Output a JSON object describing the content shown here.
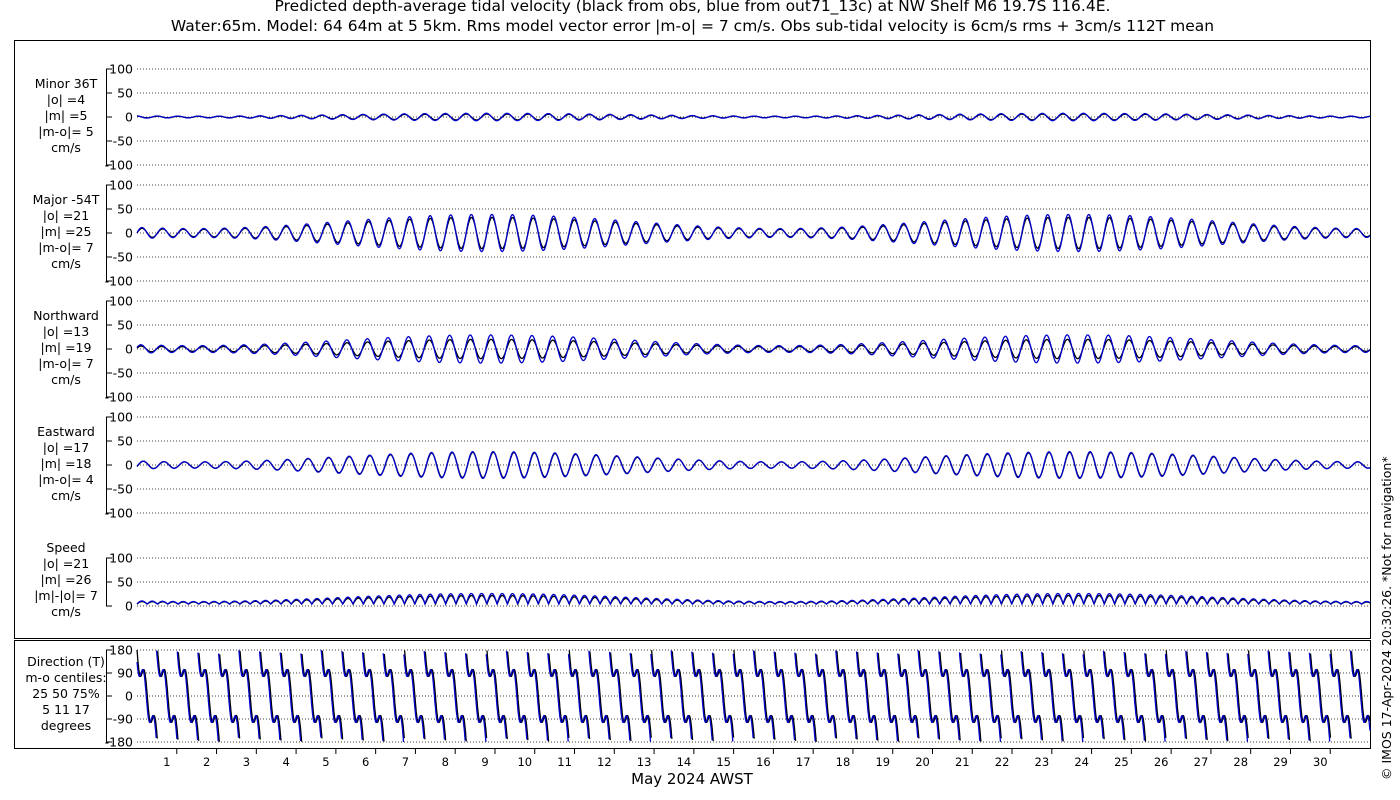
{
  "title_line1": "Predicted depth-average tidal velocity (black from obs, blue from out71_13c) at NW Shelf M6 19.7S 116.4E.",
  "title_line2": "Water:65m. Model: 64 64m at 5 5km. Rms model vector error |m-o| = 7 cm/s. Obs sub-tidal velocity is 6cm/s rms + 3cm/s 112T mean",
  "watermark": "© IMOS 17-Apr-2024 20:30:26. *Not for navigation*",
  "colors": {
    "obs": "#000000",
    "model": "#0000cc",
    "grid": "#000000"
  },
  "chart_data": {
    "type": "line",
    "xlabel": "May 2024 AWST",
    "x_range_days": [
      0,
      31
    ],
    "x_ticks": [
      "1",
      "2",
      "3",
      "4",
      "5",
      "6",
      "7",
      "8",
      "9",
      "10",
      "11",
      "12",
      "13",
      "14",
      "15",
      "16",
      "17",
      "18",
      "19",
      "20",
      "21",
      "22",
      "23",
      "24",
      "25",
      "26",
      "27",
      "28",
      "29",
      "30"
    ],
    "grid": true,
    "series_legend": {
      "obs": "black from obs",
      "model": "blue from out71_13c"
    },
    "panels": [
      {
        "id": "minor",
        "label_lines": [
          "Minor 36T",
          "|o| =4",
          "|m| =5",
          "|m-o|= 5",
          "cm/s"
        ],
        "ylim": [
          -100,
          100
        ],
        "yticks": [
          "100",
          "50",
          "0",
          "-50",
          "-100"
        ],
        "tick_values": [
          100,
          50,
          0,
          -50,
          -100
        ],
        "kind": "component",
        "amp_obs": 4,
        "amp_model": 5,
        "phase_shift": 1.6,
        "phase_lag": 0.1
      },
      {
        "id": "major",
        "label_lines": [
          "Major -54T",
          "|o| =21",
          "|m| =25",
          "|m-o|= 7",
          "cm/s"
        ],
        "ylim": [
          -100,
          100
        ],
        "yticks": [
          "100",
          "50",
          "0",
          "-50",
          "-100"
        ],
        "tick_values": [
          100,
          50,
          0,
          -50,
          -100
        ],
        "kind": "component",
        "amp_obs": 21,
        "amp_model": 25,
        "phase_shift": 0,
        "phase_lag": 0.05
      },
      {
        "id": "north",
        "label_lines": [
          "Northward",
          "|o| =13",
          "|m| =19",
          "|m-o|= 7",
          "cm/s"
        ],
        "ylim": [
          -100,
          100
        ],
        "yticks": [
          "100",
          "50",
          "0",
          "-50",
          "-100"
        ],
        "tick_values": [
          100,
          50,
          0,
          -50,
          -100
        ],
        "kind": "component",
        "amp_obs": 13,
        "amp_model": 19,
        "phase_shift": 0.3,
        "phase_lag": 0.08
      },
      {
        "id": "east",
        "label_lines": [
          "Eastward",
          "|o| =17",
          "|m| =18",
          "|m-o|= 4",
          "cm/s"
        ],
        "ylim": [
          -100,
          100
        ],
        "yticks": [
          "100",
          "50",
          "0",
          "-50",
          "-100"
        ],
        "tick_values": [
          100,
          50,
          0,
          -50,
          -100
        ],
        "kind": "component",
        "amp_obs": 17,
        "amp_model": 18,
        "phase_shift": -0.4,
        "phase_lag": 0.06
      },
      {
        "id": "speed",
        "label_lines": [
          "Speed",
          "|o| =21",
          "|m| =26",
          "|m|-|o|= 7",
          "cm/s"
        ],
        "ylim": [
          0,
          100
        ],
        "yticks": [
          "100",
          "50",
          "0"
        ],
        "tick_values": [
          100,
          50,
          0
        ],
        "kind": "speed",
        "amp_obs": 21,
        "amp_model": 26,
        "phase_shift": 0,
        "phase_lag": 0.05
      },
      {
        "id": "direction",
        "label_lines": [
          "Direction (T)",
          "m-o centiles:",
          "25  50  75%",
          "5  11  17",
          "degrees"
        ],
        "ylim": [
          -180,
          180
        ],
        "yticks": [
          "180",
          "90",
          "0",
          "-90",
          "-180"
        ],
        "tick_values": [
          180,
          90,
          0,
          -90,
          -180
        ],
        "kind": "direction",
        "amp_obs": 0,
        "amp_model": 0,
        "phase_shift": 0,
        "phase_lag": 0.05
      }
    ]
  }
}
